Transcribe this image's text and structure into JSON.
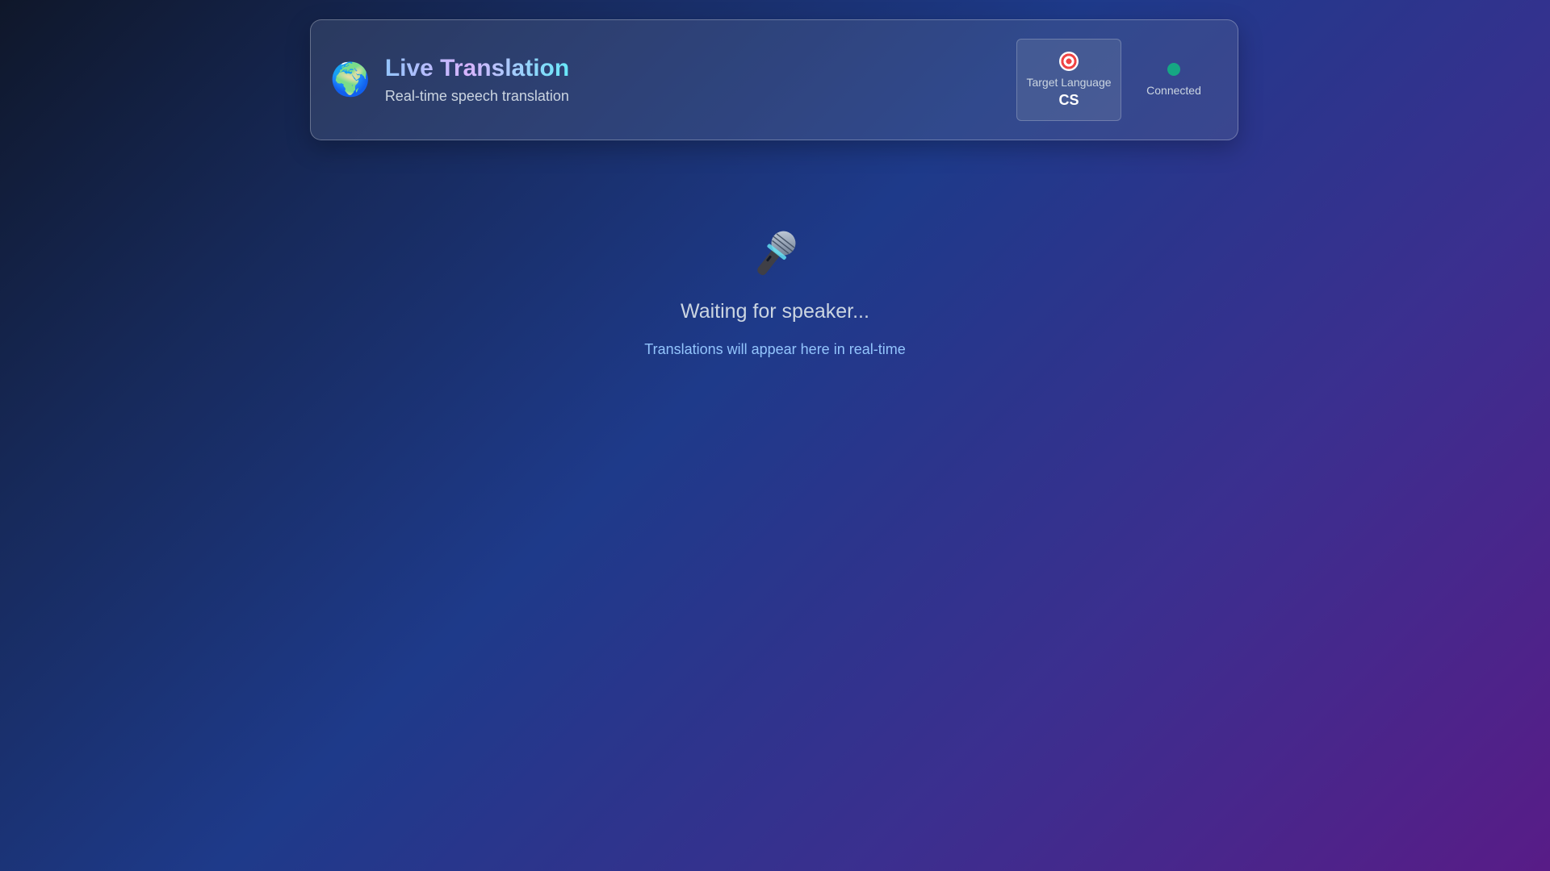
{
  "header": {
    "icon": "globe-icon",
    "title": "Live Translation",
    "subtitle": "Real-time speech translation",
    "target_language": {
      "icon": "target-icon",
      "label": "Target Language",
      "code": "CS"
    },
    "connection": {
      "icon": "status-dot-icon",
      "label": "Connected",
      "color": "#10b981"
    }
  },
  "main": {
    "icon": "microphone-icon",
    "waiting_text": "Waiting for speaker...",
    "hint_text": "Translations will appear here in real-time"
  }
}
